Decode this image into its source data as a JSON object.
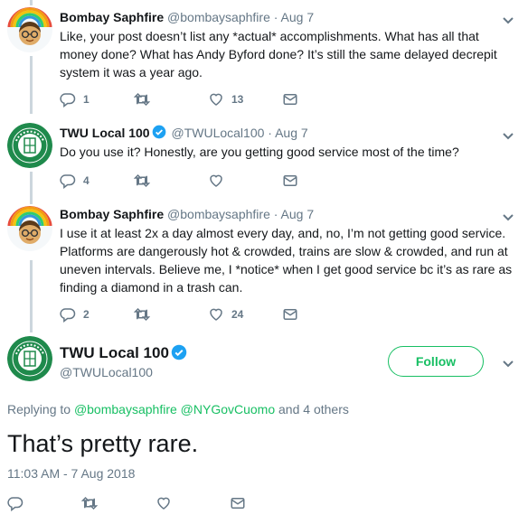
{
  "tweets": [
    {
      "name": "Bombay Saphfire",
      "handle": "@bombaysaphfire",
      "dot": "·",
      "date": "Aug 7",
      "text": "Like, your post doesn’t list any *actual* accomplishments. What has all that money done? What has Andy Byford done? It’s still the same delayed decrepit system it was a year ago.",
      "replies": "1",
      "retweets": "",
      "likes": "13"
    },
    {
      "name": "TWU Local 100",
      "handle": "@TWULocal100",
      "dot": "·",
      "date": "Aug 7",
      "text": "Do you use it? Honestly, are you getting good service most of the time?",
      "replies": "4",
      "retweets": "",
      "likes": ""
    },
    {
      "name": "Bombay Saphfire",
      "handle": "@bombaysaphfire",
      "dot": "·",
      "date": "Aug 7",
      "text": "I use it at least 2x a day almost every day, and, no, I’m not getting good service. Platforms are dangerously hot & crowded, trains are slow & crowded, and run at uneven intervals. Believe me, I *notice* when I get good service bc it’s as rare as finding a diamond in a trash can.",
      "replies": "2",
      "retweets": "",
      "likes": "24"
    }
  ],
  "main": {
    "name": "TWU Local 100",
    "handle": "@TWULocal100",
    "follow_label": "Follow",
    "replying_prefix": "Replying to",
    "replying_user1": "@bombaysaphfire",
    "replying_user2": "@NYGovCuomo",
    "replying_suffix": "and 4 others",
    "text": "That’s pretty rare.",
    "timestamp": "11:03 AM - 7 Aug 2018"
  },
  "colors": {
    "accent_green": "#17bf63",
    "verified_blue": "#1da1f2",
    "muted": "#657786",
    "thread_line": "#ccd6dd"
  },
  "icons": [
    "reply-icon",
    "retweet-icon",
    "like-icon",
    "dm-icon",
    "chevron-down-icon",
    "verified-badge-icon"
  ]
}
